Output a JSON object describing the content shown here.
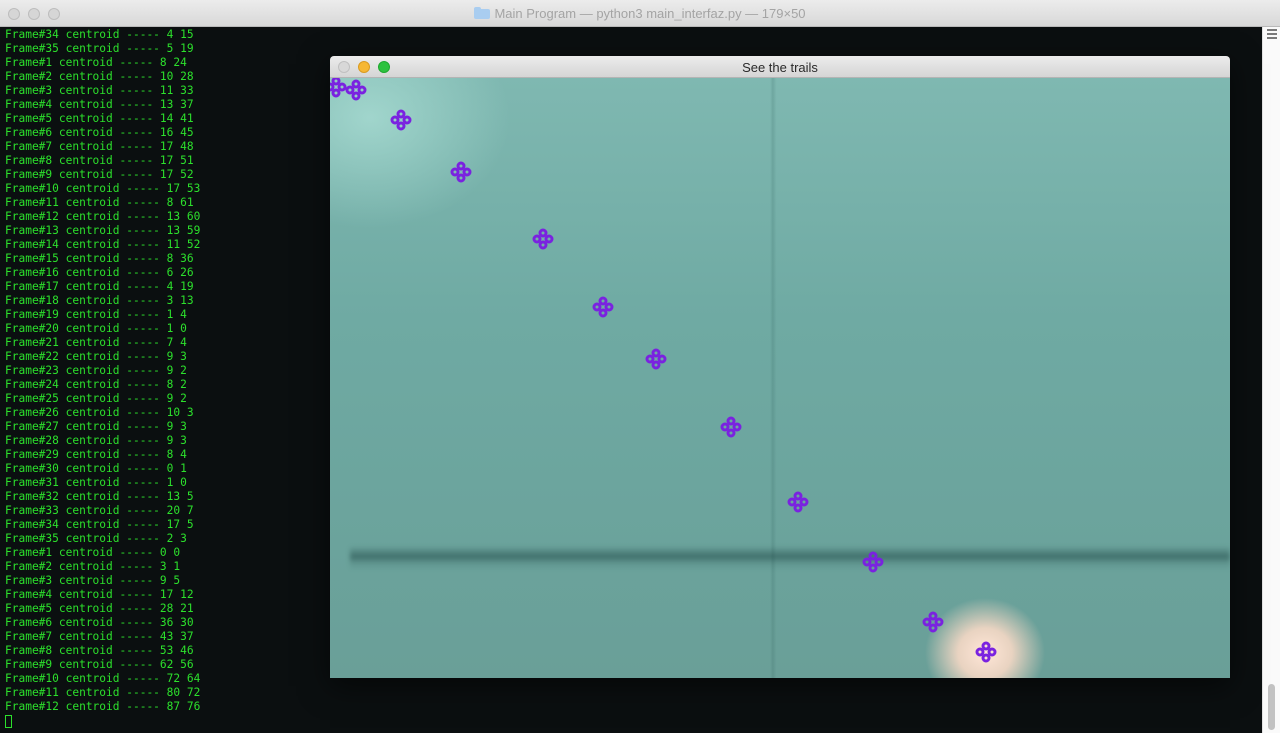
{
  "terminal": {
    "title": "Main Program — python3 main_interfaz.py — 179×50",
    "lines": [
      "Frame#34 centroid ----- 4 15",
      "Frame#35 centroid ----- 5 19",
      "Frame#1 centroid ----- 8 24",
      "Frame#2 centroid ----- 10 28",
      "Frame#3 centroid ----- 11 33",
      "Frame#4 centroid ----- 13 37",
      "Frame#5 centroid ----- 14 41",
      "Frame#6 centroid ----- 16 45",
      "Frame#7 centroid ----- 17 48",
      "Frame#8 centroid ----- 17 51",
      "Frame#9 centroid ----- 17 52",
      "Frame#10 centroid ----- 17 53",
      "Frame#11 centroid ----- 8 61",
      "Frame#12 centroid ----- 13 60",
      "Frame#13 centroid ----- 13 59",
      "Frame#14 centroid ----- 11 52",
      "Frame#15 centroid ----- 8 36",
      "Frame#16 centroid ----- 6 26",
      "Frame#17 centroid ----- 4 19",
      "Frame#18 centroid ----- 3 13",
      "Frame#19 centroid ----- 1 4",
      "Frame#20 centroid ----- 1 0",
      "Frame#21 centroid ----- 7 4",
      "Frame#22 centroid ----- 9 3",
      "Frame#23 centroid ----- 9 2",
      "Frame#24 centroid ----- 8 2",
      "Frame#25 centroid ----- 9 2",
      "Frame#26 centroid ----- 10 3",
      "Frame#27 centroid ----- 9 3",
      "Frame#28 centroid ----- 9 3",
      "Frame#29 centroid ----- 8 4",
      "Frame#30 centroid ----- 0 1",
      "Frame#31 centroid ----- 1 0",
      "Frame#32 centroid ----- 13 5",
      "Frame#33 centroid ----- 20 7",
      "Frame#34 centroid ----- 17 5",
      "Frame#35 centroid ----- 2 3",
      "Frame#1 centroid ----- 0 0",
      "Frame#2 centroid ----- 3 1",
      "Frame#3 centroid ----- 9 5",
      "Frame#4 centroid ----- 17 12",
      "Frame#5 centroid ----- 28 21",
      "Frame#6 centroid ----- 36 30",
      "Frame#7 centroid ----- 43 37",
      "Frame#8 centroid ----- 53 46",
      "Frame#9 centroid ----- 62 56",
      "Frame#10 centroid ----- 72 64",
      "Frame#11 centroid ----- 80 72",
      "Frame#12 centroid ----- 87 76"
    ]
  },
  "video_window": {
    "title": "See the trails",
    "marker_color": "#7a22e0",
    "marker_icon": "trail-marker-icon"
  },
  "colors": {
    "terminal_text": "#2ce02c",
    "terminal_bg": "#0b0f10",
    "video_bg": "#6faaa3"
  }
}
